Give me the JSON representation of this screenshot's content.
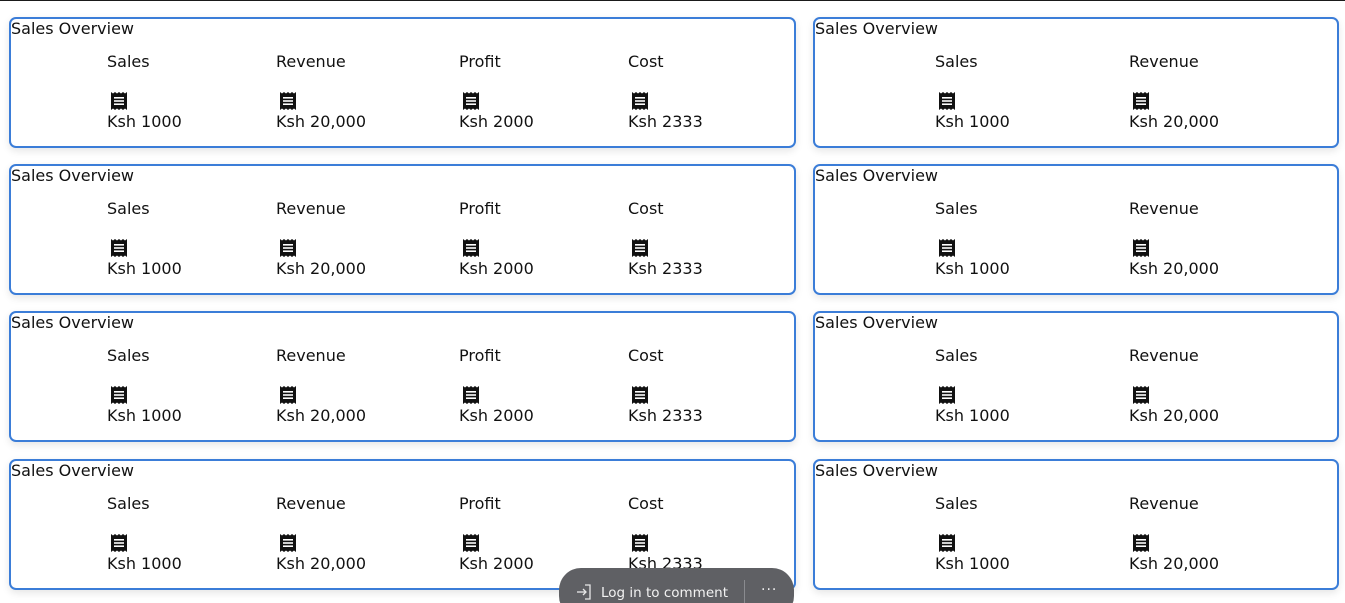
{
  "cards_left": [
    {
      "title": "Sales Overview",
      "stats": [
        {
          "label": "Sales",
          "icon": "receipt-icon",
          "value": "Ksh 1000"
        },
        {
          "label": "Revenue",
          "icon": "receipt-icon",
          "value": "Ksh 20,000"
        },
        {
          "label": "Profit",
          "icon": "receipt-icon",
          "value": "Ksh 2000"
        },
        {
          "label": "Cost",
          "icon": "receipt-icon",
          "value": "Ksh 2333"
        }
      ]
    },
    {
      "title": "Sales Overview",
      "stats": [
        {
          "label": "Sales",
          "icon": "receipt-icon",
          "value": "Ksh 1000"
        },
        {
          "label": "Revenue",
          "icon": "receipt-icon",
          "value": "Ksh 20,000"
        },
        {
          "label": "Profit",
          "icon": "receipt-icon",
          "value": "Ksh 2000"
        },
        {
          "label": "Cost",
          "icon": "receipt-icon",
          "value": "Ksh 2333"
        }
      ]
    },
    {
      "title": "Sales Overview",
      "stats": [
        {
          "label": "Sales",
          "icon": "receipt-icon",
          "value": "Ksh 1000"
        },
        {
          "label": "Revenue",
          "icon": "receipt-icon",
          "value": "Ksh 20,000"
        },
        {
          "label": "Profit",
          "icon": "receipt-icon",
          "value": "Ksh 2000"
        },
        {
          "label": "Cost",
          "icon": "receipt-icon",
          "value": "Ksh 2333"
        }
      ]
    },
    {
      "title": "Sales Overview",
      "stats": [
        {
          "label": "Sales",
          "icon": "receipt-icon",
          "value": "Ksh 1000"
        },
        {
          "label": "Revenue",
          "icon": "receipt-icon",
          "value": "Ksh 20,000"
        },
        {
          "label": "Profit",
          "icon": "receipt-icon",
          "value": "Ksh 2000"
        },
        {
          "label": "Cost",
          "icon": "receipt-icon",
          "value": "Ksh 2333"
        }
      ]
    }
  ],
  "cards_right": [
    {
      "title": "Sales Overview",
      "stats": [
        {
          "label": "Sales",
          "icon": "receipt-icon",
          "value": "Ksh 1000"
        },
        {
          "label": "Revenue",
          "icon": "receipt-icon",
          "value": "Ksh 20,000"
        }
      ]
    },
    {
      "title": "Sales Overview",
      "stats": [
        {
          "label": "Sales",
          "icon": "receipt-icon",
          "value": "Ksh 1000"
        },
        {
          "label": "Revenue",
          "icon": "receipt-icon",
          "value": "Ksh 20,000"
        }
      ]
    },
    {
      "title": "Sales Overview",
      "stats": [
        {
          "label": "Sales",
          "icon": "receipt-icon",
          "value": "Ksh 1000"
        },
        {
          "label": "Revenue",
          "icon": "receipt-icon",
          "value": "Ksh 20,000"
        }
      ]
    },
    {
      "title": "Sales Overview",
      "stats": [
        {
          "label": "Sales",
          "icon": "receipt-icon",
          "value": "Ksh 1000"
        },
        {
          "label": "Revenue",
          "icon": "receipt-icon",
          "value": "Ksh 20,000"
        }
      ]
    }
  ],
  "comment_bar": {
    "login_label": "Log in to comment",
    "login_icon": "login-icon",
    "more_label": "···",
    "more_icon": "more-icon"
  },
  "colors": {
    "card_border": "#3b7dd8",
    "comment_bar_bg": "#5f6064"
  }
}
